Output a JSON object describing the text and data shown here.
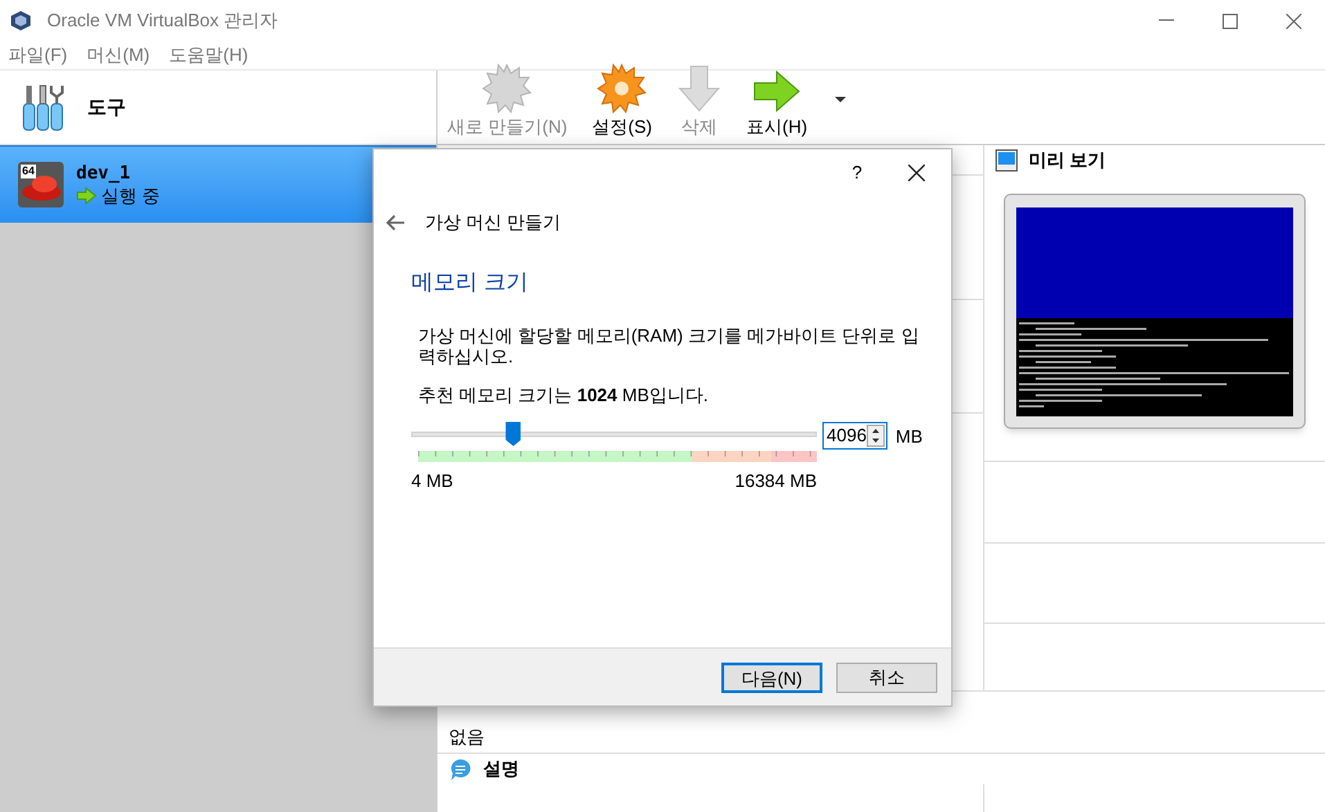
{
  "window": {
    "title": "Oracle VM VirtualBox 관리자"
  },
  "menu": [
    "파일(F)",
    "머신(M)",
    "도움말(H)"
  ],
  "tools": {
    "label": "도구"
  },
  "toolbar": [
    {
      "kind": "new",
      "label": "새로 만들기(N)",
      "disabled": true
    },
    {
      "kind": "settings",
      "label": "설정(S)",
      "disabled": false
    },
    {
      "kind": "delete",
      "label": "삭제",
      "disabled": true
    },
    {
      "kind": "show",
      "label": "표시(H)",
      "disabled": false
    }
  ],
  "vms": [
    {
      "name": "dev_1",
      "badge": "64",
      "status": "실행 중",
      "selected": true
    }
  ],
  "preview": {
    "title": "미리 보기"
  },
  "details": [
    {
      "value": "없음"
    },
    {
      "kind": "description",
      "title": "설명"
    }
  ],
  "dialog": {
    "help": "?",
    "back_title": "가상 머신 만들기",
    "heading": "메모리 크기",
    "description": "가상 머신에 할당할 메모리(RAM) 크기를 메가바이트 단위로 입력하십시오.",
    "recommended": "추천 메모리 크기는 **1024** MB입니다.",
    "memory": {
      "level": 0.25,
      "value": "4096",
      "unit": "MB",
      "min_label": "4 MB",
      "max_label": "16384 MB"
    },
    "buttons": [
      {
        "label": "다음(N)",
        "default": true
      },
      {
        "label": "취소",
        "default": false
      }
    ]
  }
}
